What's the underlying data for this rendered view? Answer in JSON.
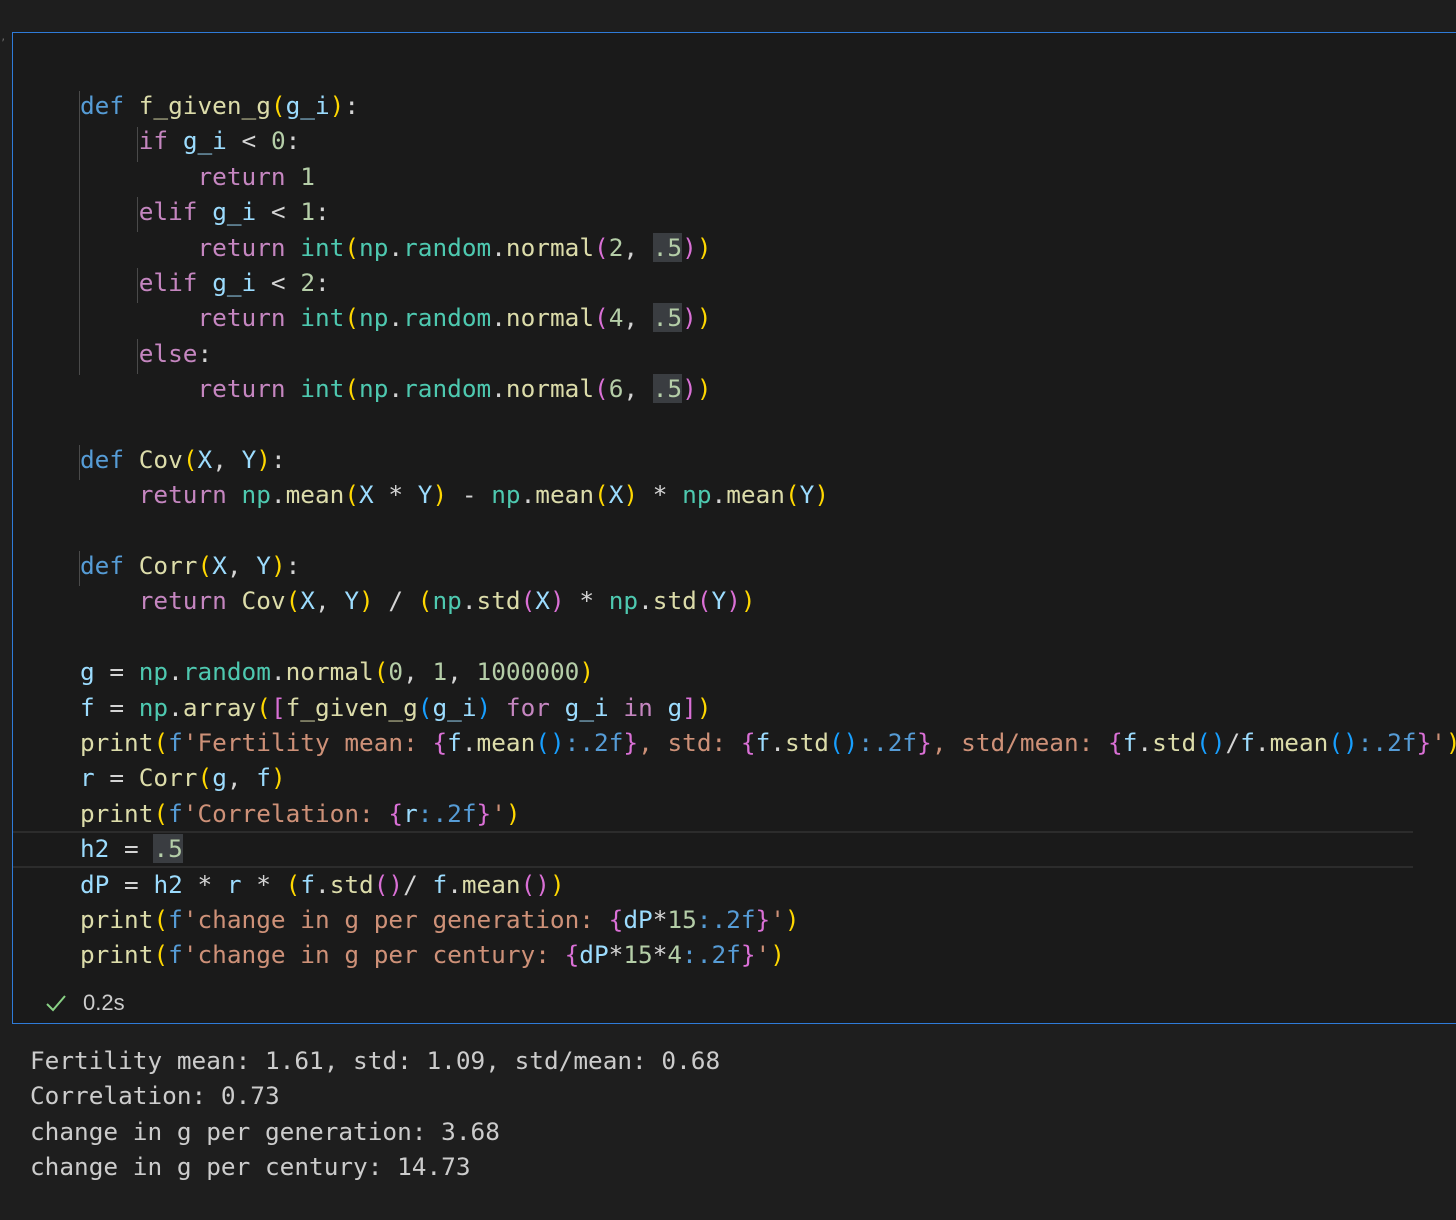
{
  "cell": {
    "code_lines": [
      "def f_given_g(g_i):",
      "    if g_i < 0:",
      "        return 1",
      "    elif g_i < 1:",
      "        return int(np.random.normal(2, .5))",
      "    elif g_i < 2:",
      "        return int(np.random.normal(4, .5))",
      "    else:",
      "        return int(np.random.normal(6, .5))",
      "",
      "def Cov(X, Y):",
      "    return np.mean(X * Y) - np.mean(X) * np.mean(Y)",
      "",
      "def Corr(X, Y):",
      "    return Cov(X, Y) / (np.std(X) * np.std(Y))",
      "",
      "g = np.random.normal(0, 1, 1000000)",
      "f = np.array([f_given_g(g_i) for g_i in g])",
      "print(f'Fertility mean: {f.mean():.2f}, std: {f.std():.2f}, std/mean: {f.std()/f.mean():.2f}')",
      "r = Corr(g, f)",
      "print(f'Correlation: {r:.2f}')",
      "h2 = .5",
      "dP = h2 * r * (f.std()/ f.mean())",
      "print(f'change in g per generation: {dP*15:.2f}')",
      "print(f'change in g per century: {dP*15*4:.2f}')"
    ],
    "execution_status_icon": "check-icon",
    "execution_time": "0.2s",
    "status_color": "#89d185",
    "border_color": "#2f7bd8"
  },
  "output": {
    "lines": [
      "Fertility mean: 1.61, std: 1.09, std/mean: 0.68",
      "Correlation: 0.73",
      "change in g per generation: 3.68",
      "change in g per century: 14.73"
    ]
  }
}
